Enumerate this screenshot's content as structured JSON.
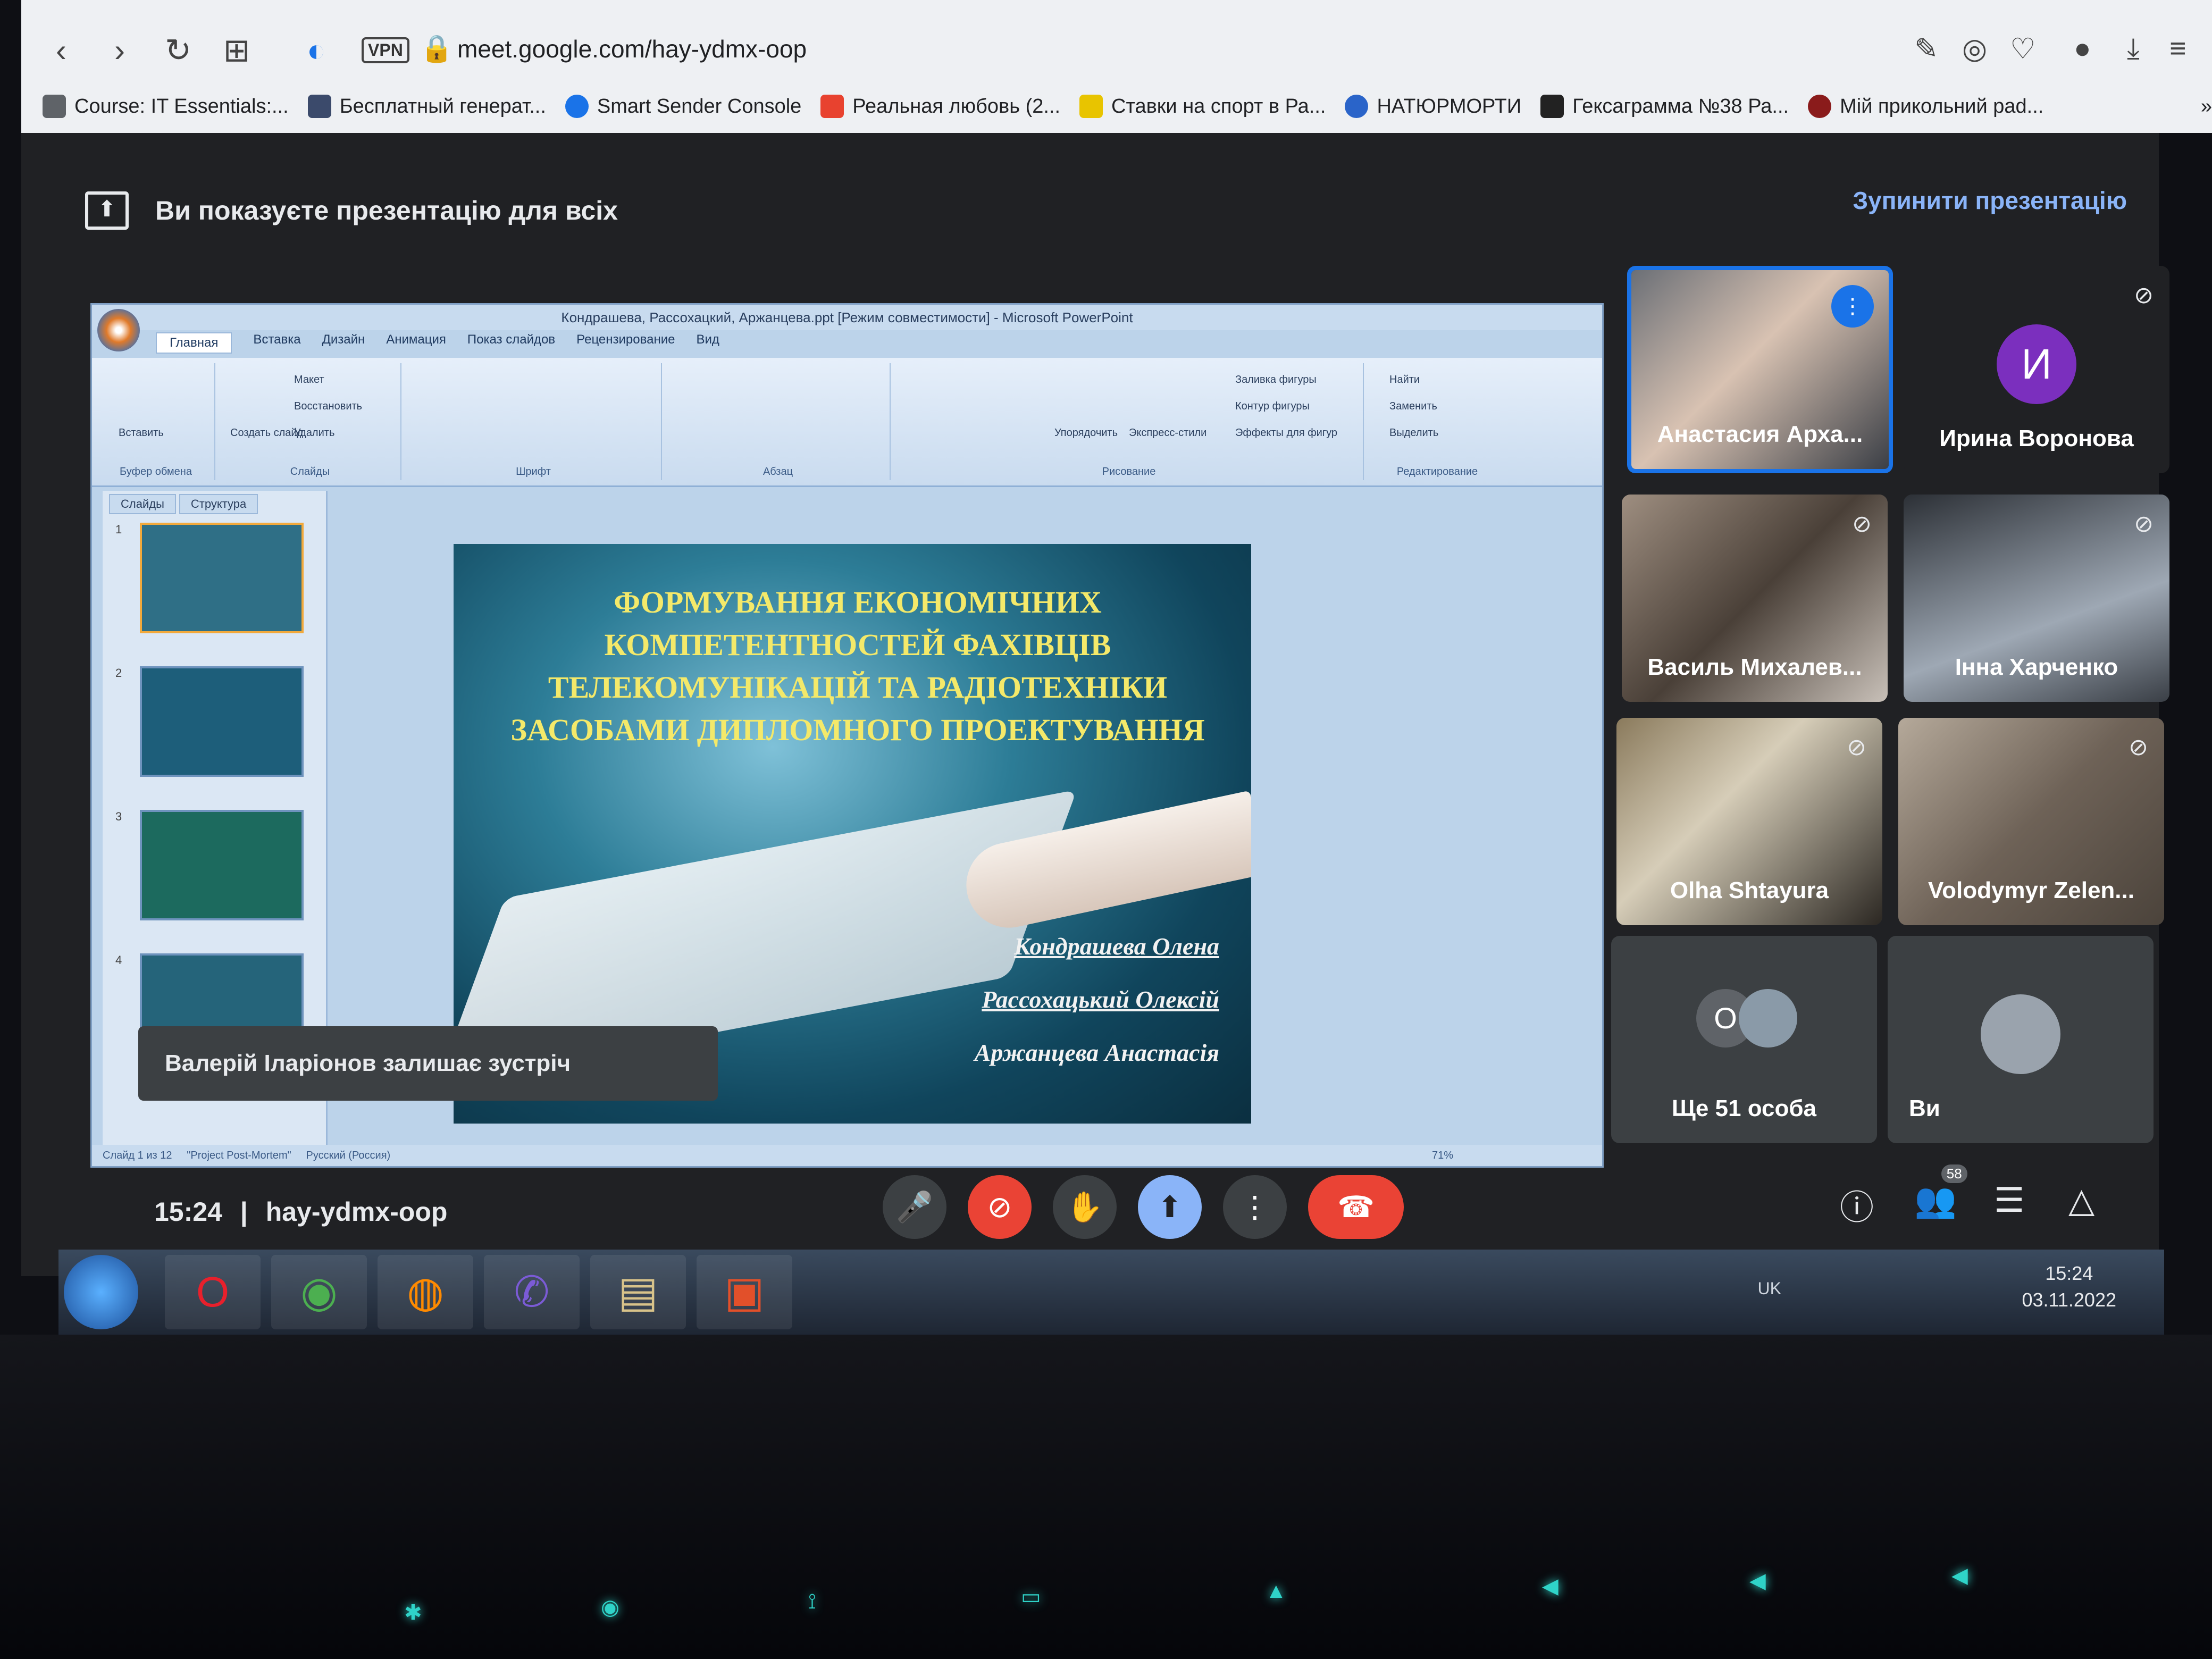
{
  "browser": {
    "url": "meet.google.com/hay-ydmx-oop",
    "vpn_label": "VPN",
    "bookmarks": [
      {
        "label": "Course: IT Essentials:...",
        "icon": "graduation-icon"
      },
      {
        "label": "Бесплатный генерат...",
        "icon": "rocket-icon"
      },
      {
        "label": "Smart Sender Console",
        "icon": "location-pin-icon"
      },
      {
        "label": "Реальная любовь (2...",
        "icon": "kinopoisk-icon"
      },
      {
        "label": "Ставки на спорт в Ра...",
        "icon": "betting-icon"
      },
      {
        "label": "НАТЮРМОРТИ",
        "icon": "globe-icon"
      },
      {
        "label": "Гексаграмма №38 Ра...",
        "icon": "figure-icon"
      },
      {
        "label": "Мій прикольний pad...",
        "icon": "pad-icon"
      }
    ]
  },
  "meet": {
    "presenting_text": "Ви показуєте презентацію для всіх",
    "stop_presenting": "Зупинити презентацію",
    "time": "15:24",
    "separator": "|",
    "meeting_code": "hay-ydmx-oop",
    "toast": "Валерій Іларіонов залишає зустріч",
    "participants_badge": "58",
    "accent_color": "#1a73e8",
    "end_call_color": "#ea4335",
    "participants": [
      {
        "name": "Анастасия Арха...",
        "speaking": true
      },
      {
        "name": "Ирина Воронова",
        "avatar_letter": "И",
        "muted": true
      },
      {
        "name": "Василь Михалев...",
        "muted": true
      },
      {
        "name": "Інна Харченко",
        "muted": true
      },
      {
        "name": "Olha Shtayura",
        "muted": true
      },
      {
        "name": "Volodymyr Zelen...",
        "muted": true
      },
      {
        "name": "Ще 51 особа",
        "avatar_letter": "О"
      },
      {
        "name": "Ви"
      }
    ]
  },
  "powerpoint": {
    "window_title": "Кондрашева, Рассохацкий, Аржанцева.ppt [Режим совместимости] - Microsoft PowerPoint",
    "tabs": [
      "Главная",
      "Вставка",
      "Дизайн",
      "Анимация",
      "Показ слайдов",
      "Рецензирование",
      "Вид"
    ],
    "groups": {
      "clipboard": "Буфер обмена",
      "slides": "Слайды",
      "font": "Шрифт",
      "paragraph": "Абзац",
      "drawing": "Рисование",
      "editing": "Редактирование"
    },
    "ribbon_items": {
      "paste": "Вставить",
      "create_slide": "Создать слайд",
      "layout": "Макет",
      "reset": "Восстановить",
      "delete": "Удалить",
      "arrange": "Упорядочить",
      "quick_styles": "Экспресс-стили",
      "shape_fill": "Заливка фигуры",
      "shape_outline": "Контур фигуры",
      "shape_effects": "Эффекты для фигур",
      "find": "Найти",
      "replace": "Заменить",
      "select": "Выделить"
    },
    "pane_tabs": [
      "Слайды",
      "Структура"
    ],
    "thumb_numbers": [
      "1",
      "2",
      "3",
      "4"
    ],
    "slide": {
      "title": "Формування економічних компетентностей фахівців телекомунікацій та радіотехніки засобами дипломного проектування",
      "authors": [
        "Кондрашева Олена",
        "Рассохацький Олексій",
        "Аржанцева Анастасія"
      ]
    },
    "status": {
      "slide_count": "Слайд 1 из 12",
      "theme": "\"Project Post-Mortem\"",
      "language": "Русский (Россия)",
      "zoom": "71%"
    }
  },
  "taskbar": {
    "lang": "UK",
    "time": "15:24",
    "date": "03.11.2022"
  }
}
